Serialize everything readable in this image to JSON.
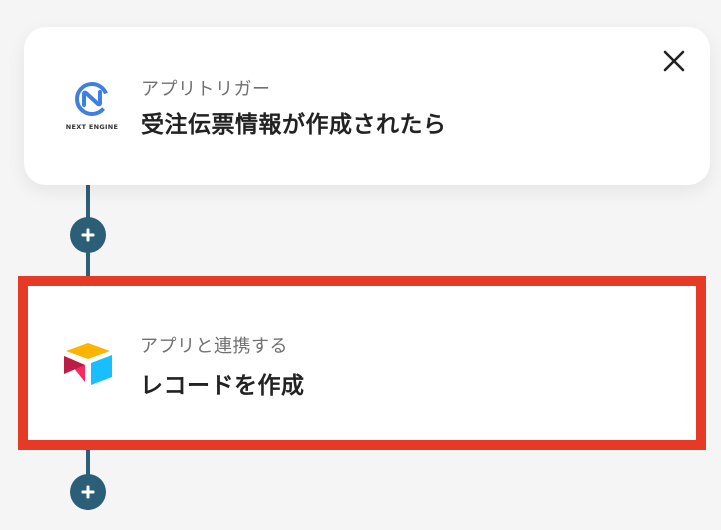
{
  "trigger_card": {
    "app_name": "NEXT ENGINE",
    "sublabel": "アプリトリガー",
    "title": "受注伝票情報が作成されたら",
    "close_icon": "close-icon"
  },
  "action_card": {
    "sublabel": "アプリと連携する",
    "title": "レコードを作成",
    "app_icon": "airtable-logo-icon",
    "highlight_color": "#e53b26"
  },
  "connector": {
    "color": "#2b5f77",
    "add_icon": "plus-icon"
  }
}
